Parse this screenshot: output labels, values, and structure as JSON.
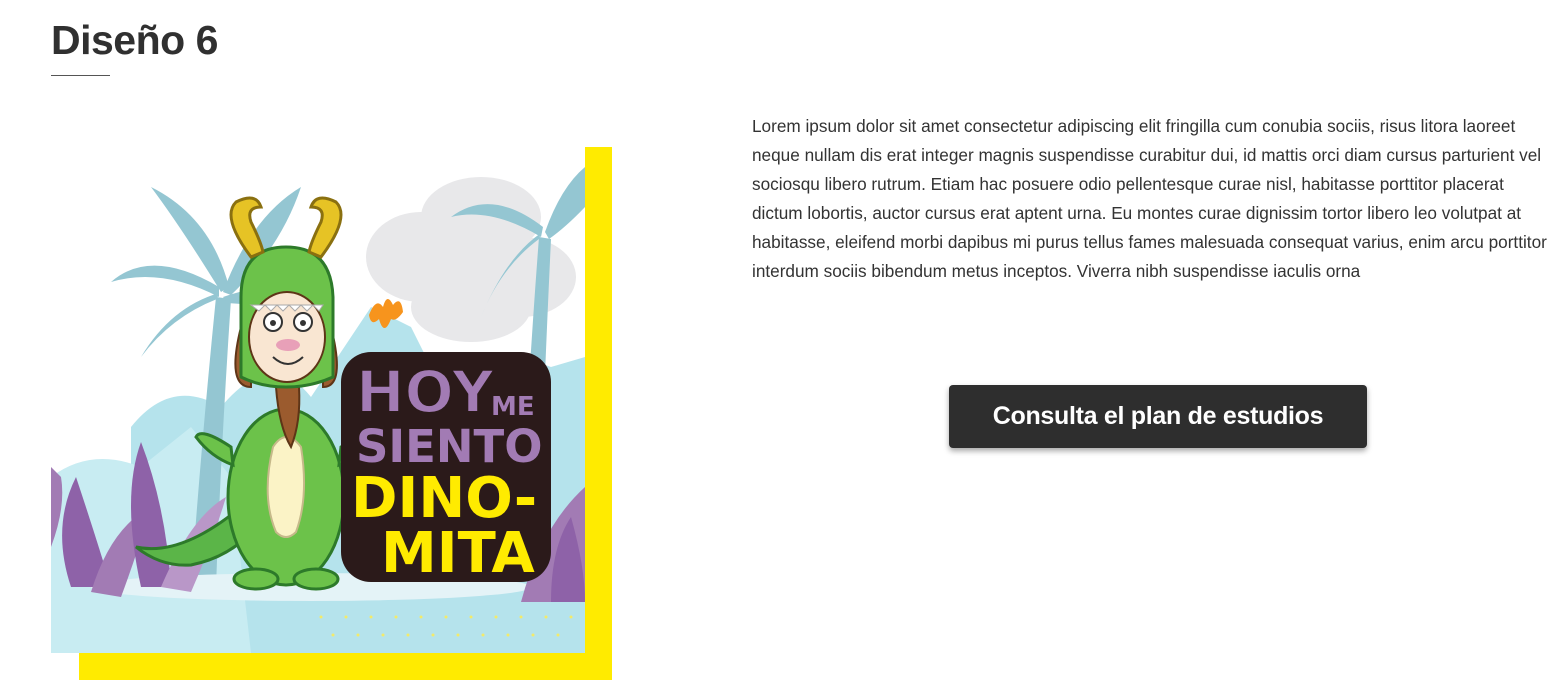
{
  "page": {
    "title": "Diseño 6"
  },
  "illustration": {
    "caption_line1": "HOY",
    "caption_line1_small": "ME",
    "caption_line2": "SIENTO",
    "caption_line3": "DINO-",
    "caption_line4": "MITA",
    "frame_color": "#ffeb00",
    "purple": "#a27bb4",
    "yellow": "#ffeb00"
  },
  "content": {
    "description": "Lorem ipsum dolor sit amet consectetur adipiscing elit fringilla cum conubia sociis, risus litora laoreet neque nullam dis erat integer magnis suspendisse curabitur dui, id mattis orci diam cursus parturient vel sociosqu libero rutrum. Etiam hac posuere odio pellentesque curae nisl, habitasse porttitor placerat dictum lobortis, auctor cursus erat aptent urna. Eu montes curae dignissim tortor libero leo volutpat at habitasse, eleifend morbi dapibus mi purus tellus fames malesuada consequat varius, enim arcu porttitor interdum sociis bibendum metus inceptos. Viverra nibh suspendisse iaculis orna",
    "cta_label": "Consulta el plan de estudios"
  },
  "colors": {
    "button_bg": "#2e2e2e",
    "button_text": "#ffffff",
    "text": "#333333"
  }
}
